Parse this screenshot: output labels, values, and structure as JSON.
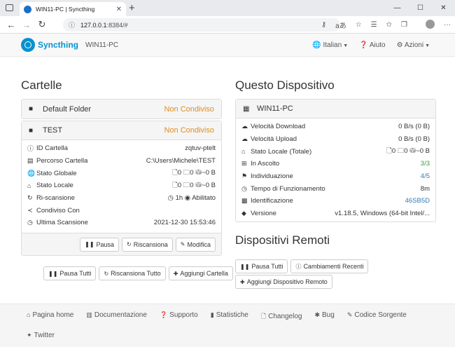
{
  "browser": {
    "tab_title": "WIN11-PC | Syncthing",
    "url_host": "127.0.0.1",
    "url_rest": ":8384/#"
  },
  "navbar": {
    "brand": "Syncthing",
    "device": "WIN11-PC",
    "language": "Italian",
    "help": "Aiuto",
    "actions": "Azioni"
  },
  "folders": {
    "heading": "Cartelle",
    "default_folder": {
      "name": "Default Folder",
      "status": "Non Condiviso"
    },
    "test": {
      "name": "TEST",
      "status": "Non Condiviso",
      "rows": [
        {
          "label": "ID Cartella",
          "value": "zqtuv-ptelt"
        },
        {
          "label": "Percorso Cartella",
          "value": "C:\\Users\\Michele\\TEST"
        },
        {
          "label": "Stato Globale",
          "value": "🗋0  🗀0  ⛁~0 B"
        },
        {
          "label": "Stato Locale",
          "value": "🗋0  🗀0  ⛁~0 B"
        },
        {
          "label": "Ri-scansione",
          "value": "◷ 1h  ◉ Abilitato"
        },
        {
          "label": "Condiviso Con",
          "value": ""
        },
        {
          "label": "Ultima Scansione",
          "value": "2021-12-30 15:53:46"
        }
      ],
      "buttons": {
        "pause": "Pausa",
        "rescan": "Riscansiona",
        "edit": "Modifica"
      }
    },
    "actions": {
      "pause_all": "Pausa Tutti",
      "rescan_all": "Riscansiona Tutto",
      "add_folder": "Aggiungi Cartella"
    }
  },
  "device": {
    "heading": "Questo Dispositivo",
    "name": "WIN11-PC",
    "rows": [
      {
        "label": "Velocità Download",
        "value": "0 B/s (0 B)"
      },
      {
        "label": "Velocità Upload",
        "value": "0 B/s (0 B)"
      },
      {
        "label": "Stato Locale (Totale)",
        "value": "🗋0  🗀0  ⛁~0 B"
      },
      {
        "label": "In Ascolto",
        "value": "3/3"
      },
      {
        "label": "Individuazione",
        "value": "4/5"
      },
      {
        "label": "Tempo di Funzionamento",
        "value": "8m"
      },
      {
        "label": "Identificazione",
        "value": "46SB5D"
      },
      {
        "label": "Versione",
        "value": "v1.18.5, Windows (64-bit Intel/..."
      }
    ]
  },
  "remote": {
    "heading": "Dispositivi Remoti",
    "pause_all": "Pausa Tutti",
    "recent_changes": "Cambiamenti Recenti",
    "add_device": "Aggiungi Dispositivo Remoto"
  },
  "footer": {
    "links": [
      "Pagina home",
      "Documentazione",
      "Supporto",
      "Statistiche",
      "Changelog",
      "Bug",
      "Codice Sorgente",
      "Twitter"
    ]
  }
}
